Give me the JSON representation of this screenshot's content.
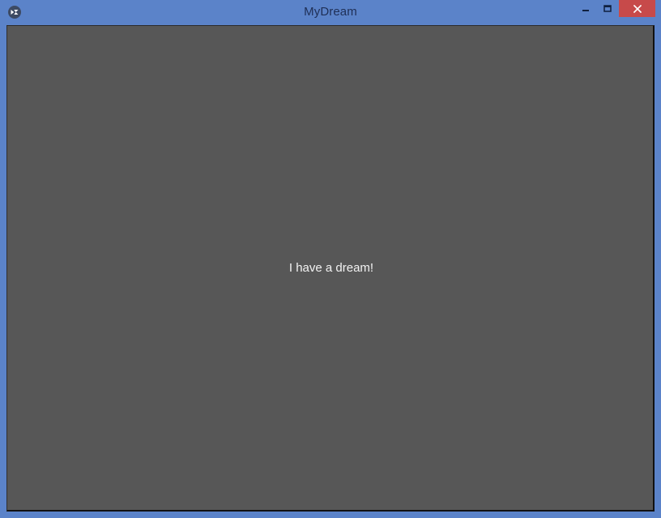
{
  "window": {
    "title": "MyDream",
    "icon": "kivy-app-icon"
  },
  "controls": {
    "minimize_icon": "minimize-icon",
    "maximize_icon": "maximize-icon",
    "close_icon": "close-icon"
  },
  "content": {
    "message": "I have a dream!"
  },
  "colors": {
    "titlebar": "#5b83c9",
    "client_background": "#575757",
    "close_button": "#c74a4a",
    "message_text": "#f2f2f2"
  }
}
